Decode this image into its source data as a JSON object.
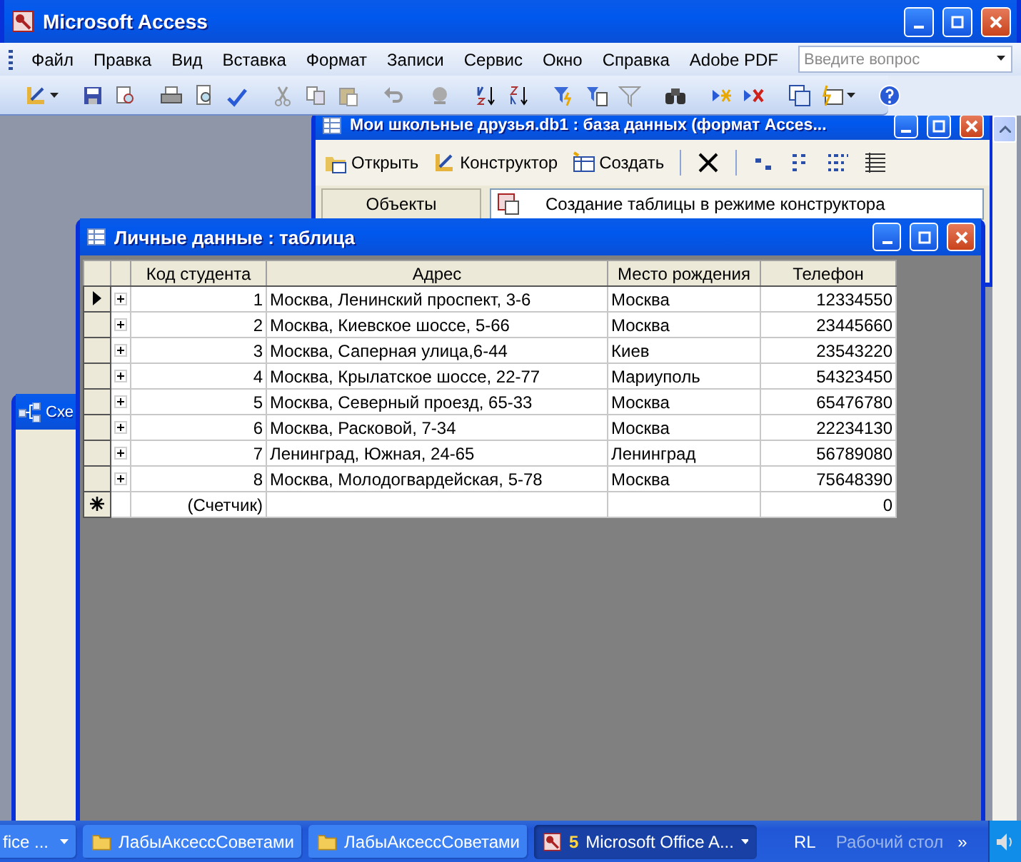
{
  "window": {
    "title": "Microsoft Access"
  },
  "menu": [
    "Файл",
    "Правка",
    "Вид",
    "Вставка",
    "Формат",
    "Записи",
    "Сервис",
    "Окно",
    "Справка",
    "Adobe PDF"
  ],
  "help_search": {
    "placeholder": "Введите вопрос"
  },
  "database_window": {
    "title": "Мои школьные друзья.db1 : база данных (формат Acces...",
    "toolbar": [
      "Открыть",
      "Конструктор",
      "Создать"
    ],
    "objects_header": "Объекты",
    "items": [
      "Создание таблицы в режиме конструктора"
    ]
  },
  "schema_window": {
    "title": "Схе"
  },
  "table_window": {
    "title": "Личные данные : таблица",
    "columns": [
      "Код студента",
      "Адрес",
      "Место рождения",
      "Телефон"
    ],
    "rows": [
      {
        "selected": true,
        "cells": [
          "1",
          "Москва, Ленинский проспект, 3-6",
          "Москва",
          "12334550"
        ]
      },
      {
        "selected": false,
        "cells": [
          "2",
          "Москва, Киевское шоссе, 5-66",
          "Москва",
          "23445660"
        ]
      },
      {
        "selected": false,
        "cells": [
          "3",
          "Москва, Саперная улица,6-44",
          "Киев",
          "23543220"
        ]
      },
      {
        "selected": false,
        "cells": [
          "4",
          "Москва, Крылатское шоссе, 22-77",
          "Мариуполь",
          "54323450"
        ]
      },
      {
        "selected": false,
        "cells": [
          "5",
          "Москва, Северный проезд, 65-33",
          "Москва",
          "65476780"
        ]
      },
      {
        "selected": false,
        "cells": [
          "6",
          "Москва, Расковой, 7-34",
          "Москва",
          "22234130"
        ]
      },
      {
        "selected": false,
        "cells": [
          "7",
          "Ленинград, Южная, 24-65",
          "Ленинград",
          "56789080"
        ]
      },
      {
        "selected": false,
        "cells": [
          "8",
          "Москва, Молодогвардейская, 5-78",
          "Москва",
          "75648390"
        ]
      }
    ],
    "new_row": {
      "code": "(Счетчик)",
      "phone": "0"
    }
  },
  "taskbar": {
    "buttons": [
      {
        "kind": "group",
        "label": "fice ...",
        "selected": false
      },
      {
        "kind": "folder",
        "label": "ЛабыАксессСоветами",
        "selected": false
      },
      {
        "kind": "folder",
        "label": "ЛабыАксессСоветами",
        "selected": false
      },
      {
        "kind": "app",
        "count": "5",
        "label": "Microsoft Office A...",
        "selected": true
      }
    ],
    "toolbar_label": "RL",
    "desktop": "Рабочий стол",
    "chevron": "»"
  }
}
